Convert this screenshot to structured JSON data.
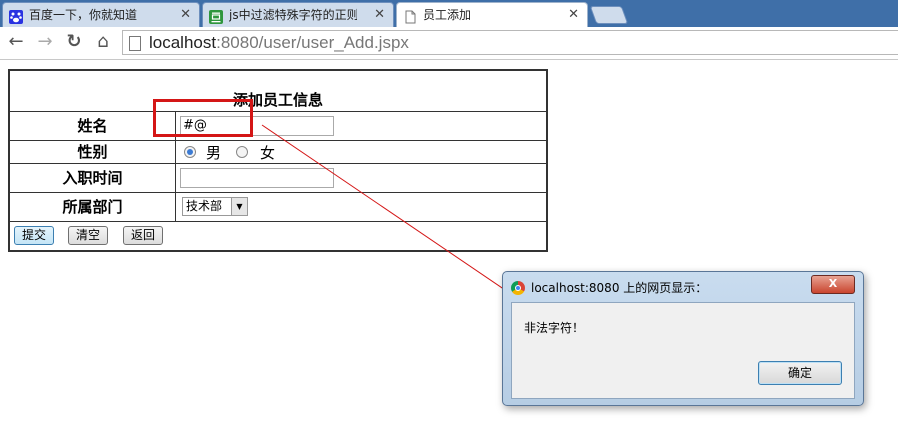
{
  "tabs": [
    {
      "title": "百度一下，你就知道",
      "close": "✕",
      "icon": "baidu-paw-icon"
    },
    {
      "title": "js中过滤特殊字符的正则表",
      "close": "✕",
      "icon": "douban-icon"
    },
    {
      "title": "员工添加",
      "close": "✕",
      "icon": "page-icon"
    }
  ],
  "toolbar": {
    "back": "←",
    "forward": "→",
    "reload": "↻",
    "home": "⌂",
    "url_host": "localhost",
    "url_path": ":8080/user/user_Add.jspx"
  },
  "form": {
    "caption": "添加员工信息",
    "name_label": "姓名",
    "name_value": "#@",
    "gender_label": "性别",
    "gender_male": "男",
    "gender_female": "女",
    "gender_selected": "男",
    "hire_label": "入职时间",
    "hire_value": "",
    "dept_label": "所属部门",
    "dept_value": "技术部",
    "submit": "提交",
    "clear": "清空",
    "back": "返回"
  },
  "dialog": {
    "title": "localhost:8080 上的网页显示：",
    "close": "X",
    "message": "非法字符！",
    "ok": "确定"
  },
  "colors": {
    "annotation_red": "#d41616",
    "tabstrip": "#3f6fa8"
  }
}
